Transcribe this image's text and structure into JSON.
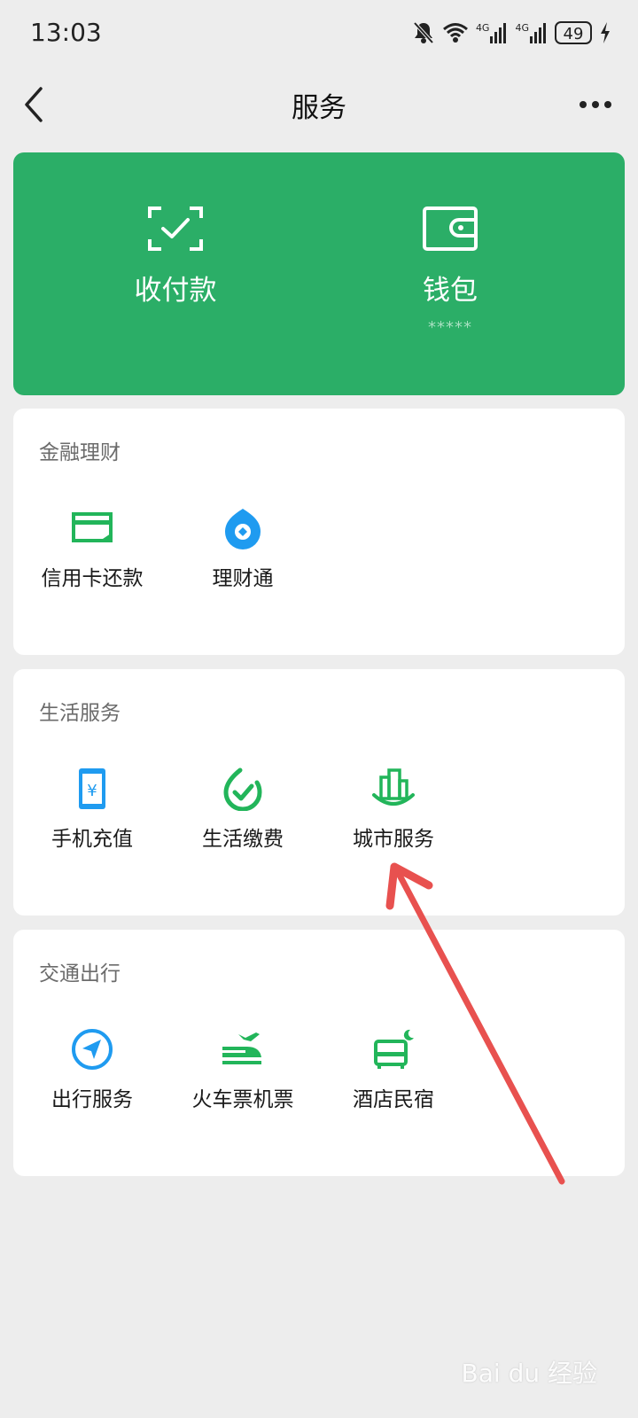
{
  "status_bar": {
    "time": "13:03",
    "network_1": "4G",
    "network_2": "4G",
    "battery": "49",
    "icons": [
      "bell-off-icon",
      "wifi-icon",
      "signal-icon",
      "signal-icon",
      "battery-icon",
      "charging-icon"
    ]
  },
  "nav": {
    "title": "服务",
    "back_icon": "chevron-left-icon",
    "more_icon": "more-dots-icon"
  },
  "wallet_card": {
    "color": "#2bae67",
    "items": [
      {
        "label": "收付款",
        "icon": "scan-pay-icon"
      },
      {
        "label": "钱包",
        "sub": "*****",
        "icon": "wallet-icon"
      }
    ]
  },
  "sections": [
    {
      "title": "金融理财",
      "items": [
        {
          "label": "信用卡还款",
          "icon": "credit-card-icon"
        },
        {
          "label": "理财通",
          "icon": "wealth-icon"
        }
      ]
    },
    {
      "title": "生活服务",
      "items": [
        {
          "label": "手机充值",
          "icon": "phone-recharge-icon"
        },
        {
          "label": "生活缴费",
          "icon": "utility-payment-icon"
        },
        {
          "label": "城市服务",
          "icon": "city-service-icon"
        }
      ]
    },
    {
      "title": "交通出行",
      "items": [
        {
          "label": "出行服务",
          "icon": "navigation-icon"
        },
        {
          "label": "火车票机票",
          "icon": "train-plane-icon"
        },
        {
          "label": "酒店民宿",
          "icon": "hotel-icon"
        }
      ]
    }
  ],
  "colors": {
    "accent_green": "#2bae67",
    "icon_blue": "#1f9bf0",
    "icon_green": "#22b55a",
    "annotation_red": "#e8514f"
  },
  "watermark": "Bai du 经验"
}
